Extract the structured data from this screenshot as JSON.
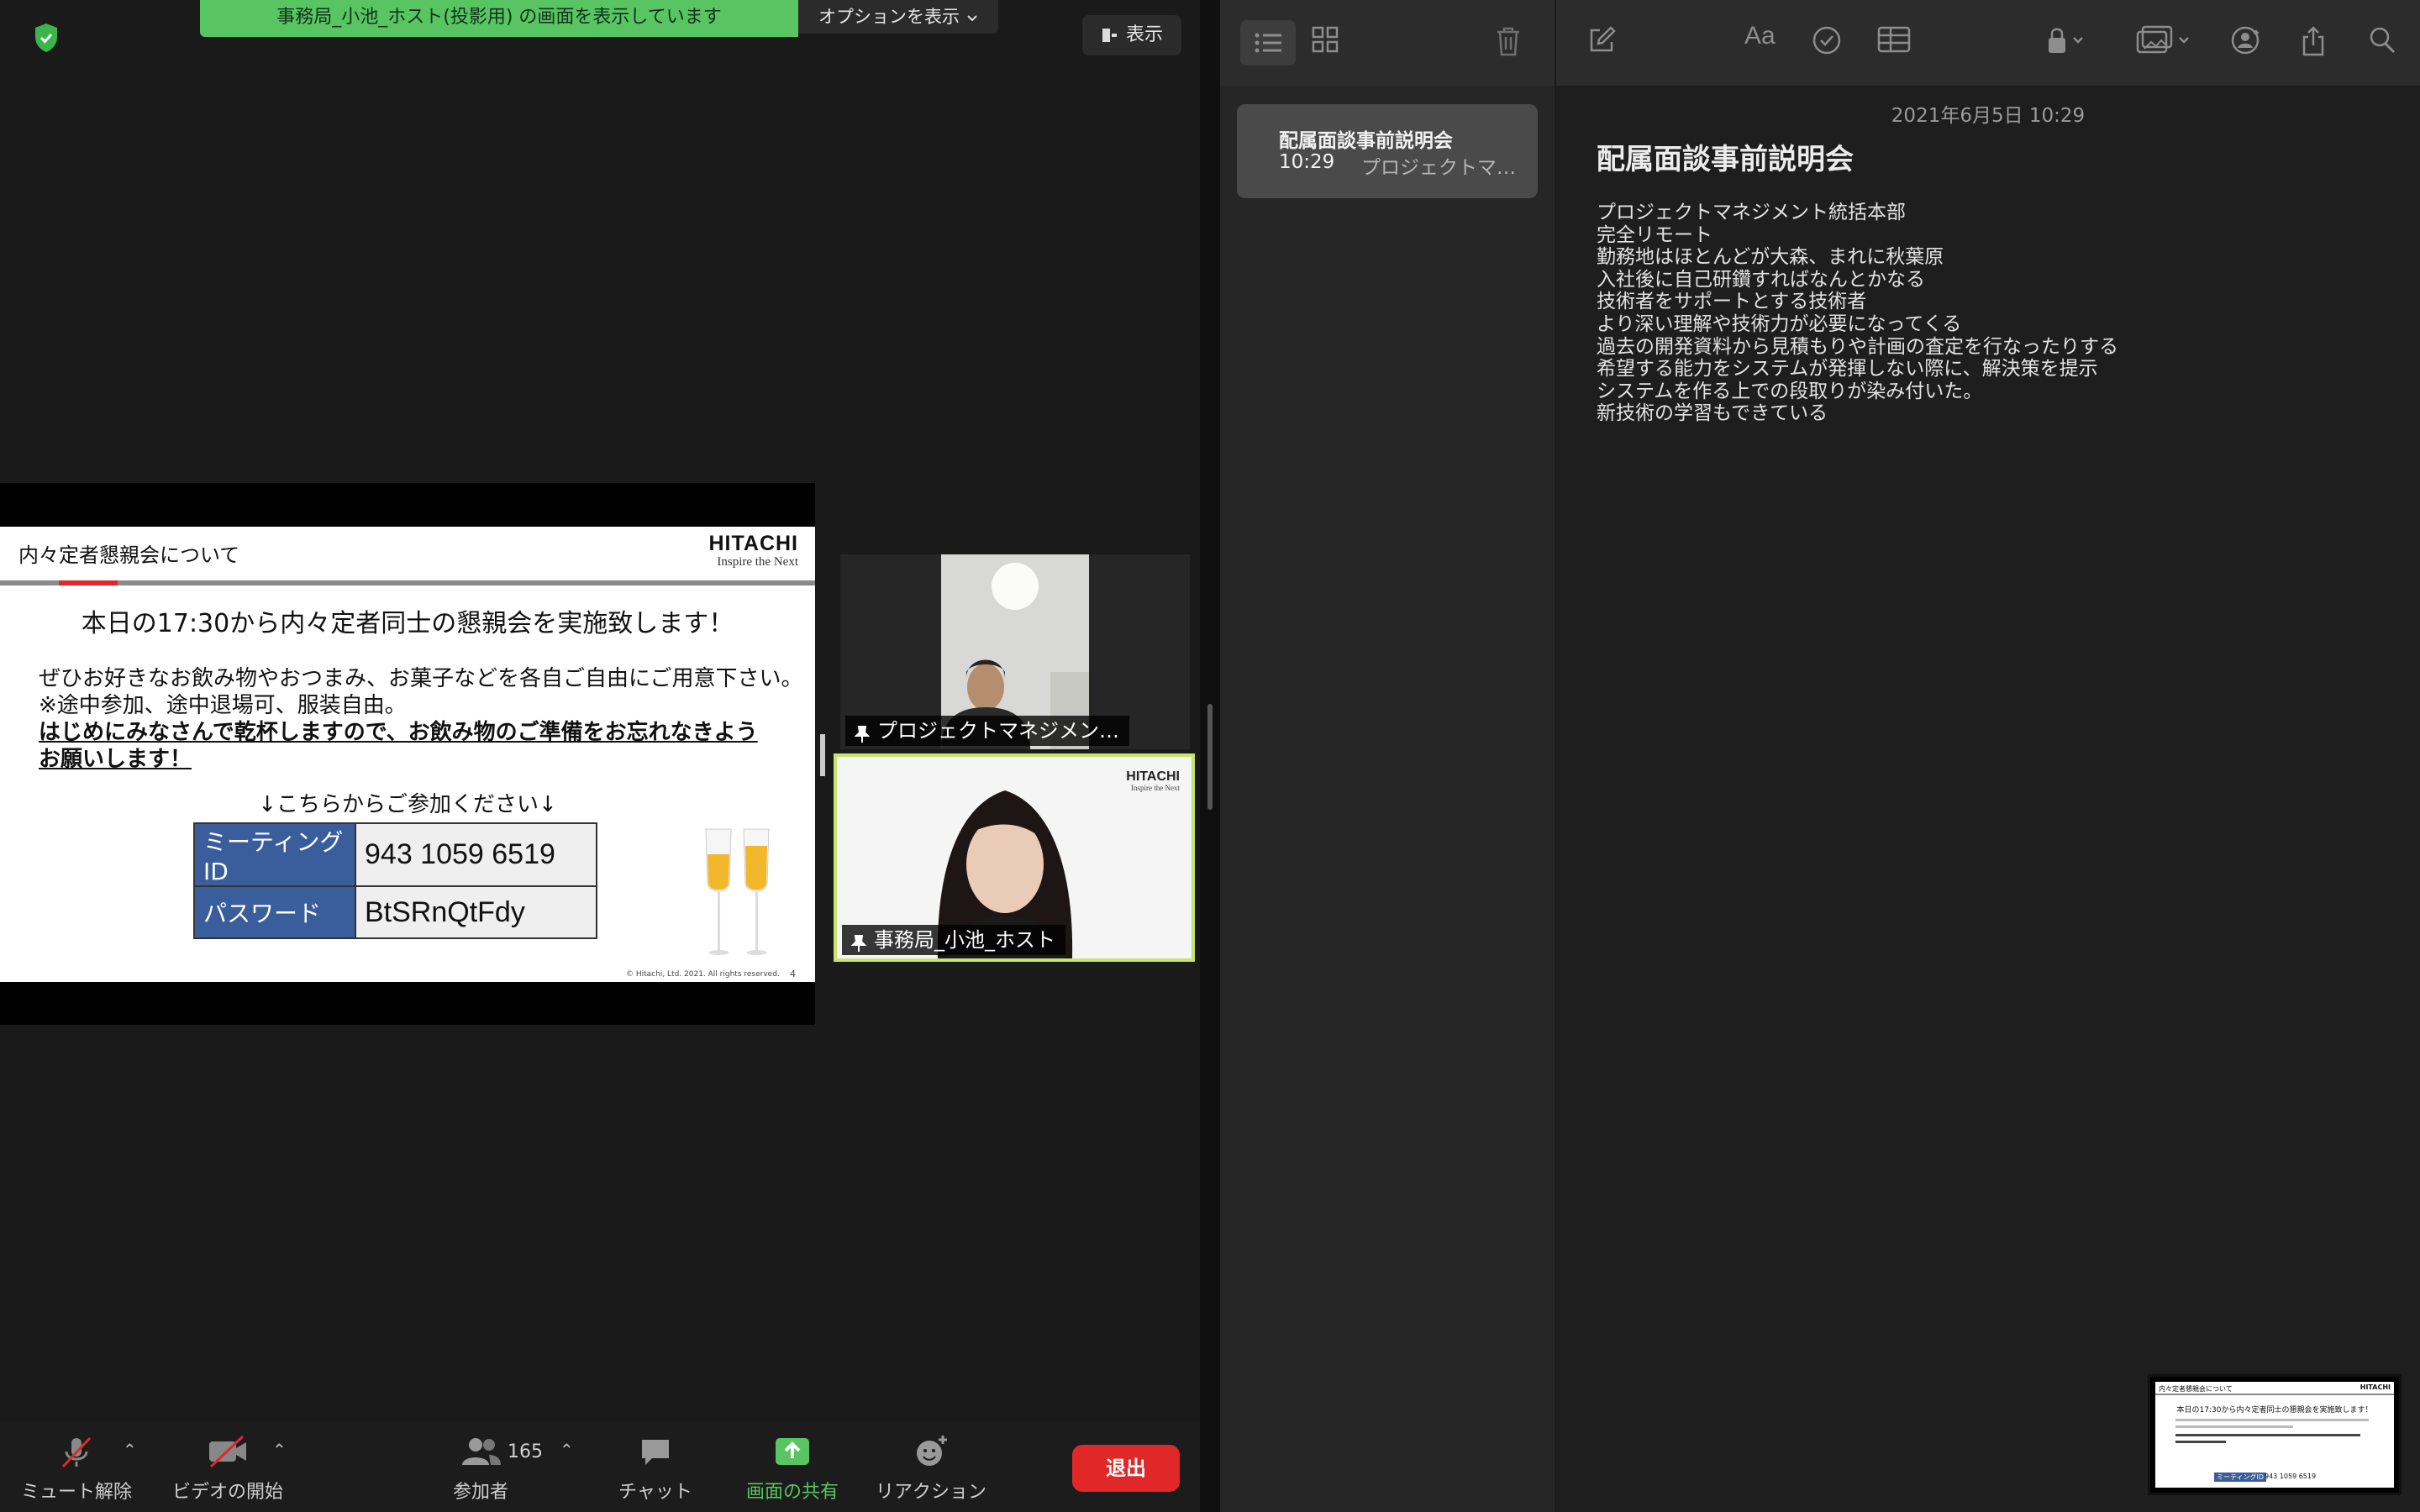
{
  "zoom": {
    "share_banner": "事務局_小池_ホスト(投影用) の画面を表示しています",
    "options_label": "オプションを表示",
    "view_label": "表示",
    "slide": {
      "title": "内々定者懇親会について",
      "logo_brand": "HITACHI",
      "logo_tagline": "Inspire the Next",
      "headline": "本日の17:30から内々定者同士の懇親会を実施致します！",
      "line1": "ぜひお好きなお飲み物やおつまみ、お菓子などを各自ご自由にご用意下さい。",
      "line2": "※途中参加、途中退場可、服装自由。",
      "line3": "はじめにみなさんで乾杯しますので、お飲み物のご準備をお忘れなきよう",
      "line4": "お願いします！",
      "join": "↓こちらからご参加ください↓",
      "meeting_id_label": "ミーティングID",
      "meeting_id": "943 1059 6519",
      "password_label": "パスワード",
      "password": "BtSRnQtFdy",
      "copyright": "© Hitachi, Ltd. 2021. All rights reserved.",
      "page_num": "4"
    },
    "participants": [
      {
        "name": "プロジェクトマネジメン…"
      },
      {
        "name": "事務局_小池_ホスト"
      }
    ],
    "toolbar": {
      "mute": "ミュート解除",
      "video": "ビデオの開始",
      "participants": "参加者",
      "participant_count": "165",
      "chat": "チャット",
      "share": "画面の共有",
      "reaction": "リアクション",
      "leave": "退出"
    },
    "colors": {
      "share_green": "#58c462",
      "leave_red": "#e02828",
      "active_border": "#c9e36b"
    }
  },
  "notes": {
    "list": [
      {
        "title": "配属面談事前説明会",
        "time": "10:29",
        "preview": "プロジェクトマ…"
      }
    ],
    "editor": {
      "date": "2021年6月5日 10:29",
      "title": "配属面談事前説明会",
      "lines": [
        "プロジェクトマネジメント統括本部",
        "完全リモート",
        "勤務地はほとんどが大森、まれに秋葉原",
        "入社後に自己研鑽すればなんとかなる",
        "技術者をサポートとする技術者",
        "より深い理解や技術力が必要になってくる",
        "過去の開発資料から見積もりや計画の査定を行なったりする",
        "希望する能力をシステムが発揮しない際に、解決策を提示",
        "システムを作る上での段取りが染み付いた。",
        "新技術の学習もできている"
      ]
    },
    "toolbar_icons": [
      "list-view-icon",
      "gallery-view-icon",
      "trash-icon",
      "compose-icon",
      "format-icon",
      "checklist-icon",
      "table-icon",
      "lock-icon",
      "media-icon",
      "collaborate-icon",
      "share-icon",
      "search-icon"
    ]
  },
  "thumbnail": {
    "title": "内々定者懇親会について",
    "brand": "HITACHI",
    "headline": "本日の17:30から内々定者同士の懇親会を実施致します！",
    "meeting_id_label": "ミーティングID",
    "meeting_id": "943 1059 6519"
  }
}
